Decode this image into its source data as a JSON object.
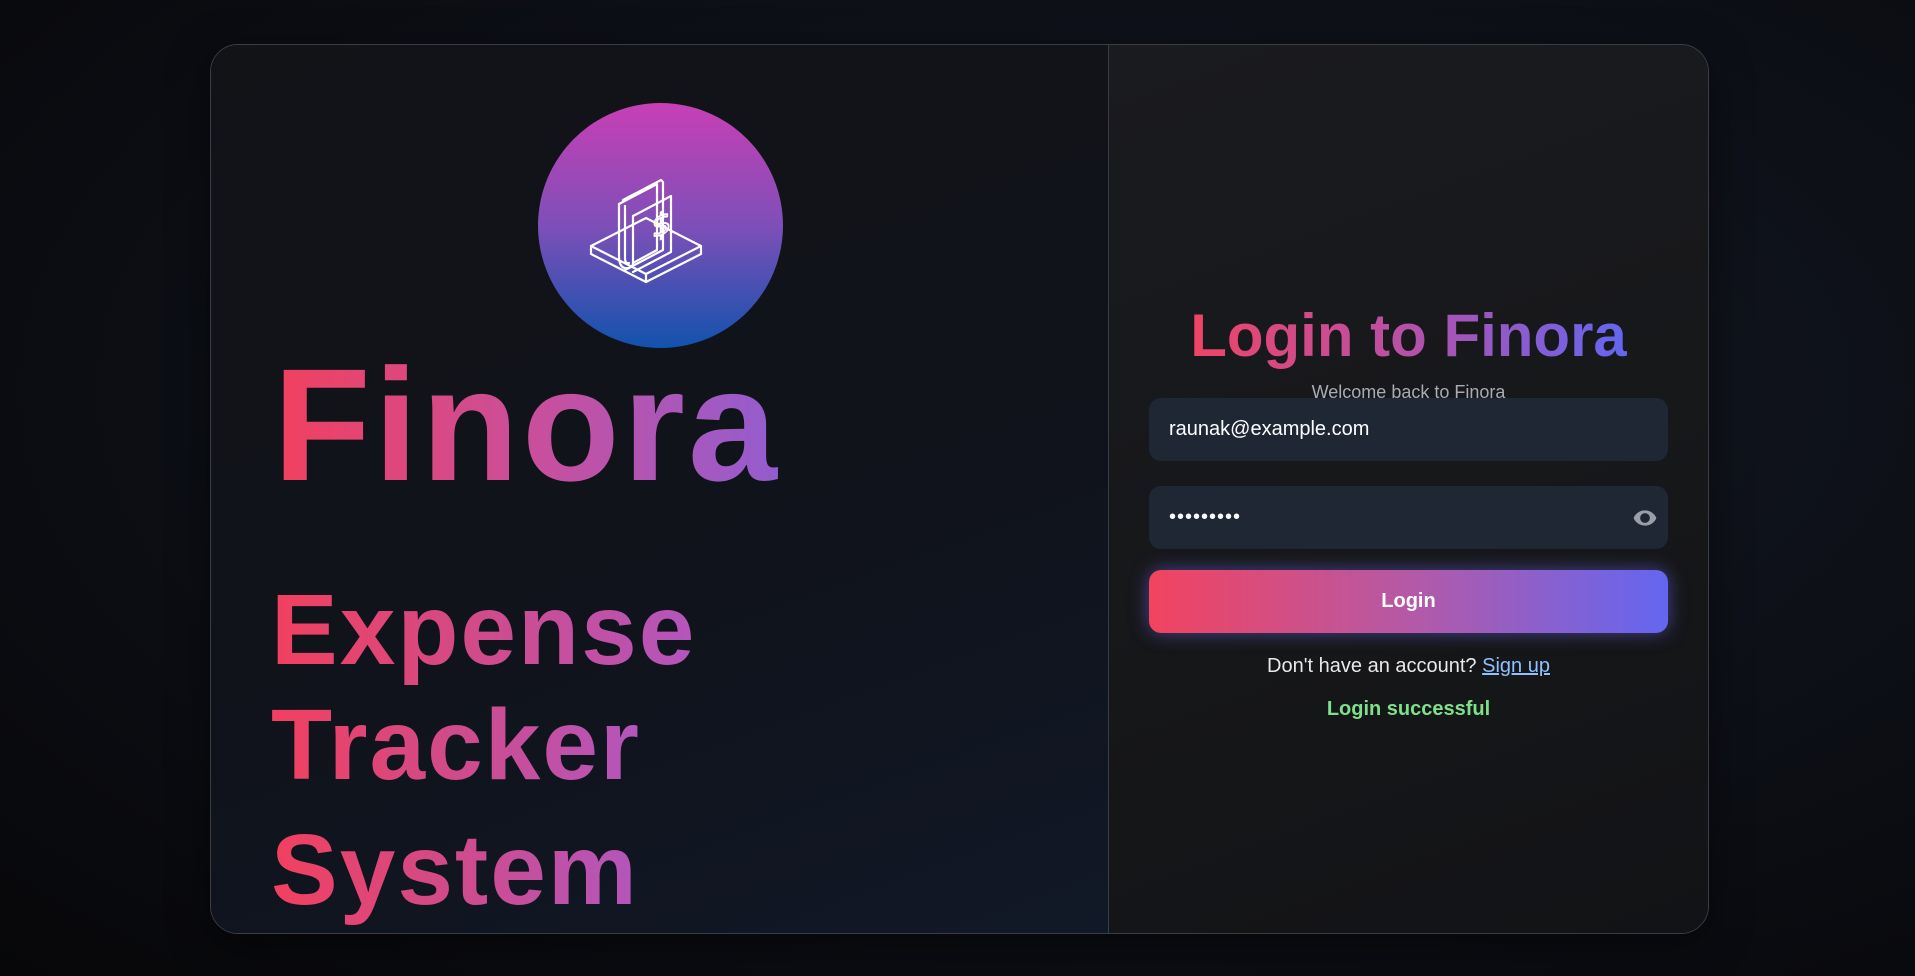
{
  "brand": {
    "name": "Finora",
    "tagline": [
      "Expense",
      "Tracker",
      "System"
    ],
    "logo_icon": "wallet-dollar-icon"
  },
  "login": {
    "title": "Login to Finora",
    "subtitle": "Welcome back to Finora",
    "email_value": "raunak@example.com",
    "password_mask": "•••••••••",
    "password_toggle_icon": "eye-icon",
    "button_label": "Login",
    "signup_prompt": "Don't have an account?",
    "signup_link": "Sign up",
    "status_message": "Login successful"
  },
  "colors": {
    "accent_pink": "#f2405f",
    "accent_indigo": "#6366f1",
    "success": "#7ee08a",
    "link": "#8fc0ff"
  }
}
